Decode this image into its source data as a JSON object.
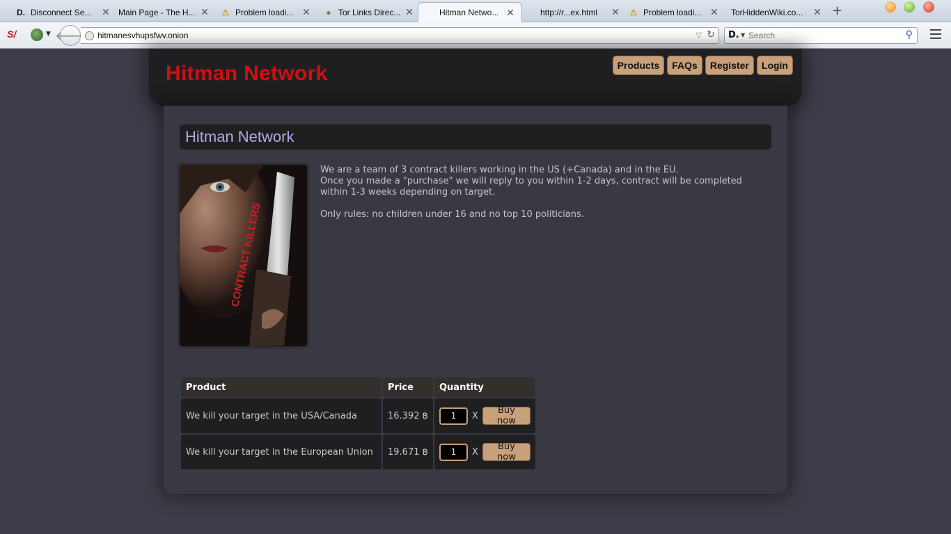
{
  "browser": {
    "tabs": [
      {
        "label": "Disconnect Se...",
        "icon": "disconnect-icon"
      },
      {
        "label": "Main Page - The H...",
        "icon": "none"
      },
      {
        "label": "Problem loadi...",
        "icon": "warning-icon"
      },
      {
        "label": "Tor Links Direc...",
        "icon": "onion-icon"
      },
      {
        "label": "Hitman Netwo...",
        "icon": "none",
        "active": true
      },
      {
        "label": "http://r...ex.html",
        "icon": "none"
      },
      {
        "label": "Problem loadi...",
        "icon": "warning-icon"
      },
      {
        "label": "TorHiddenWiki.co...",
        "icon": "none"
      }
    ],
    "url": "hitmanesvhupsfwv.onion",
    "search_placeholder": "Search",
    "search_engine_glyph": "D."
  },
  "site": {
    "logo": "Hitman Network",
    "menu": [
      "Products",
      "FAQs",
      "Register",
      "Login"
    ],
    "accent_color": "#c8a07a",
    "title_color": "#d10f0f"
  },
  "content": {
    "title": "Hitman Network",
    "poster_text": "CONTRACT KILLERS",
    "intro_lines": [
      "We are a team of 3 contract killers working in the US (+Canada) and in the EU.",
      "Once you made a \"purchase\" we will reply to you within 1-2 days, contract will be completed within 1-3 weeks depending on target."
    ],
    "rules": "Only rules: no children under 16 and no top 10 politicians."
  },
  "products": {
    "headers": [
      "Product",
      "Price",
      "Quantity"
    ],
    "rows": [
      {
        "name": "We kill your target in the USA/Canada",
        "price": "16.392 ฿",
        "qty": "1",
        "times": "X",
        "buy": "Buy now"
      },
      {
        "name": "We kill your target in the European Union",
        "price": "19.671 ฿",
        "qty": "1",
        "times": "X",
        "buy": "Buy now"
      }
    ]
  }
}
